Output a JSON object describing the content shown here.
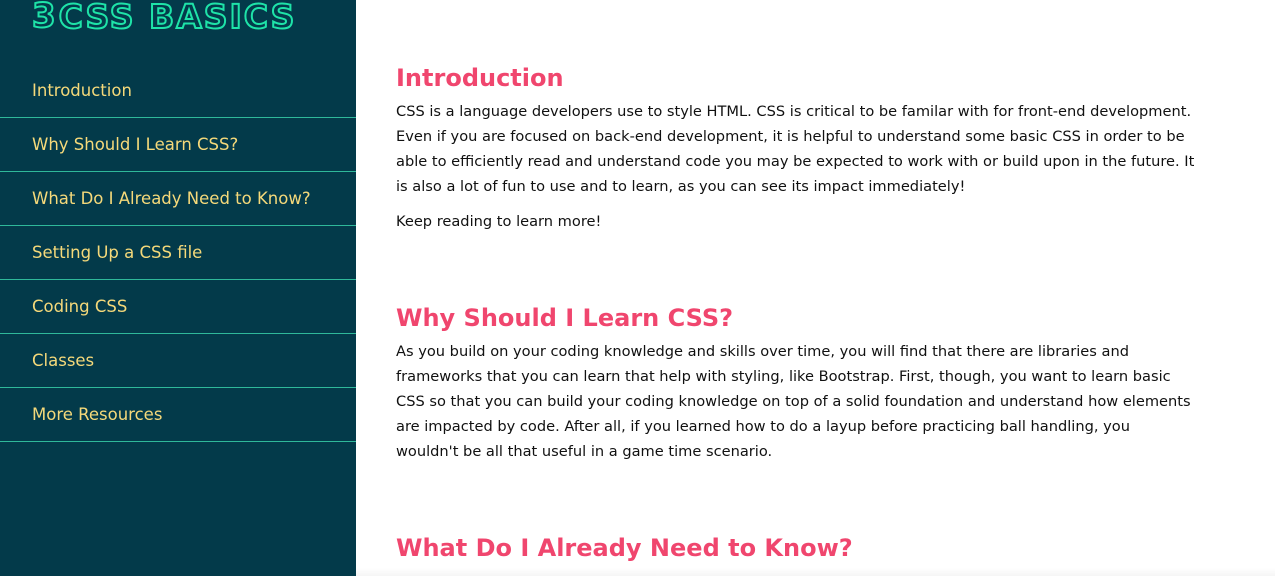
{
  "sidebar": {
    "logo_text": "CSS BASICS",
    "logo_icon": "css3-icon",
    "items": [
      {
        "label": "Introduction"
      },
      {
        "label": "Why Should I Learn CSS?"
      },
      {
        "label": "What Do I Already Need to Know?"
      },
      {
        "label": "Setting Up a CSS file"
      },
      {
        "label": "Coding CSS"
      },
      {
        "label": "Classes"
      },
      {
        "label": "More Resources"
      }
    ]
  },
  "main": {
    "sections": [
      {
        "title": "Introduction",
        "paragraphs": [
          "CSS is a language developers use to style HTML. CSS is critical to be familar with for front-end development. Even if you are focused on back-end development, it is helpful to understand some basic CSS in order to be able to efficiently read and understand code you may be expected to work with or build upon in the future. It is also a lot of fun to use and to learn, as you can see its impact immediately!",
          "Keep reading to learn more!"
        ]
      },
      {
        "title": "Why Should I Learn CSS?",
        "paragraphs": [
          "As you build on your coding knowledge and skills over time, you will find that there are libraries and frameworks that you can learn that help with styling, like Bootstrap. First, though, you want to learn basic CSS so that you can build your coding knowledge on top of a solid foundation and understand how elements are impacted by code. After all, if you learned how to do a layup before practicing ball handling, you wouldn't be all that useful in a game time scenario."
        ]
      },
      {
        "title": "What Do I Already Need to Know?",
        "paragraphs": []
      }
    ]
  },
  "colors": {
    "sidebar_bg": "#033a4a",
    "nav_text": "#f5d97a",
    "nav_divider": "#2fb89a",
    "logo_accent": "#1ee3a8",
    "heading": "#f0466e",
    "body_text": "#111111"
  }
}
